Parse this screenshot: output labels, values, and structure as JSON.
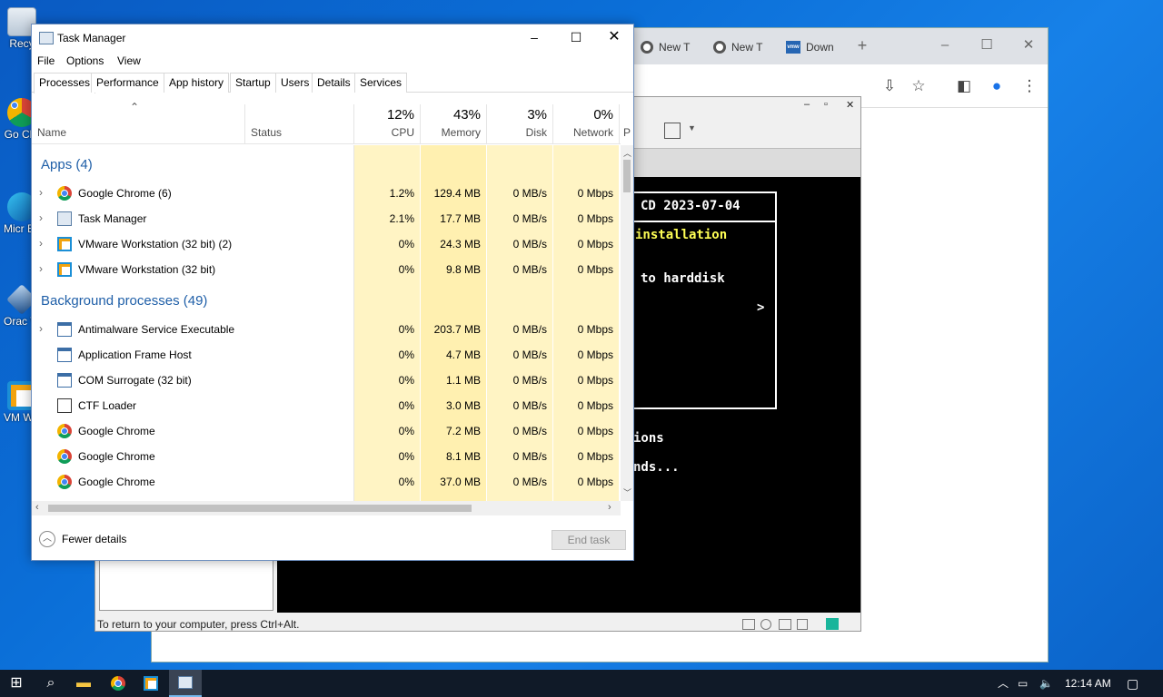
{
  "desktop": {
    "icons": [
      {
        "label": "Recy"
      },
      {
        "label": "Go Chr"
      },
      {
        "label": "Micr Ed"
      },
      {
        "label": "Orac Virtu"
      },
      {
        "label": "VM Work"
      }
    ]
  },
  "chrome": {
    "tabs": [
      {
        "label": "New T"
      },
      {
        "label": "New T"
      },
      {
        "label": "Down"
      }
    ],
    "new_tab": "+",
    "minimize": "–",
    "maximize": "☐",
    "close": "✕"
  },
  "vmware": {
    "status": "To return to your computer, press Ctrl+Alt.",
    "console_lines": [
      "CD 2023-07-04",
      "installation",
      "to harddisk",
      ">",
      "ions",
      "nds..."
    ]
  },
  "task_manager": {
    "title": "Task Manager",
    "menu": [
      "File",
      "Options",
      "View"
    ],
    "tabs": [
      "Processes",
      "Performance",
      "App history",
      "Startup",
      "Users",
      "Details",
      "Services"
    ],
    "columns": {
      "name": "Name",
      "status": "Status",
      "cpu": {
        "pct": "12%",
        "label": "CPU"
      },
      "memory": {
        "pct": "43%",
        "label": "Memory"
      },
      "disk": {
        "pct": "3%",
        "label": "Disk"
      },
      "network": {
        "pct": "0%",
        "label": "Network"
      },
      "power": "P"
    },
    "groups": {
      "apps": "Apps (4)",
      "background": "Background processes (49)"
    },
    "apps": [
      {
        "name": "Google Chrome (6)",
        "cpu": "1.2%",
        "memory": "129.4 MB",
        "disk": "0 MB/s",
        "network": "0 Mbps",
        "icon": "chrome-icon"
      },
      {
        "name": "Task Manager",
        "cpu": "2.1%",
        "memory": "17.7 MB",
        "disk": "0 MB/s",
        "network": "0 Mbps",
        "icon": "task-manager-icon"
      },
      {
        "name": "VMware Workstation (32 bit) (2)",
        "cpu": "0%",
        "memory": "24.3 MB",
        "disk": "0 MB/s",
        "network": "0 Mbps",
        "icon": "vmware-icon"
      },
      {
        "name": "VMware Workstation (32 bit)",
        "cpu": "0%",
        "memory": "9.8 MB",
        "disk": "0 MB/s",
        "network": "0 Mbps",
        "icon": "vmware-icon"
      }
    ],
    "background": [
      {
        "name": "Antimalware Service Executable",
        "cpu": "0%",
        "memory": "203.7 MB",
        "disk": "0 MB/s",
        "network": "0 Mbps",
        "icon": "system-app-icon"
      },
      {
        "name": "Application Frame Host",
        "cpu": "0%",
        "memory": "4.7 MB",
        "disk": "0 MB/s",
        "network": "0 Mbps",
        "icon": "system-app-icon"
      },
      {
        "name": "COM Surrogate (32 bit)",
        "cpu": "0%",
        "memory": "1.1 MB",
        "disk": "0 MB/s",
        "network": "0 Mbps",
        "icon": "system-app-icon"
      },
      {
        "name": "CTF Loader",
        "cpu": "0%",
        "memory": "3.0 MB",
        "disk": "0 MB/s",
        "network": "0 Mbps",
        "icon": "ctf-loader-icon"
      },
      {
        "name": "Google Chrome",
        "cpu": "0%",
        "memory": "7.2 MB",
        "disk": "0 MB/s",
        "network": "0 Mbps",
        "icon": "chrome-icon"
      },
      {
        "name": "Google Chrome",
        "cpu": "0%",
        "memory": "8.1 MB",
        "disk": "0 MB/s",
        "network": "0 Mbps",
        "icon": "chrome-icon"
      },
      {
        "name": "Google Chrome",
        "cpu": "0%",
        "memory": "37.0 MB",
        "disk": "0 MB/s",
        "network": "0 Mbps",
        "icon": "chrome-icon"
      }
    ],
    "footer": {
      "fewer_details": "Fewer details",
      "end_task": "End task"
    },
    "colors": {
      "heat_light": "#fff4c4",
      "heat_mid": "#fff0b0",
      "group_text": "#1f5fa8"
    }
  },
  "taskbar": {
    "clock": "12:14 AM"
  }
}
